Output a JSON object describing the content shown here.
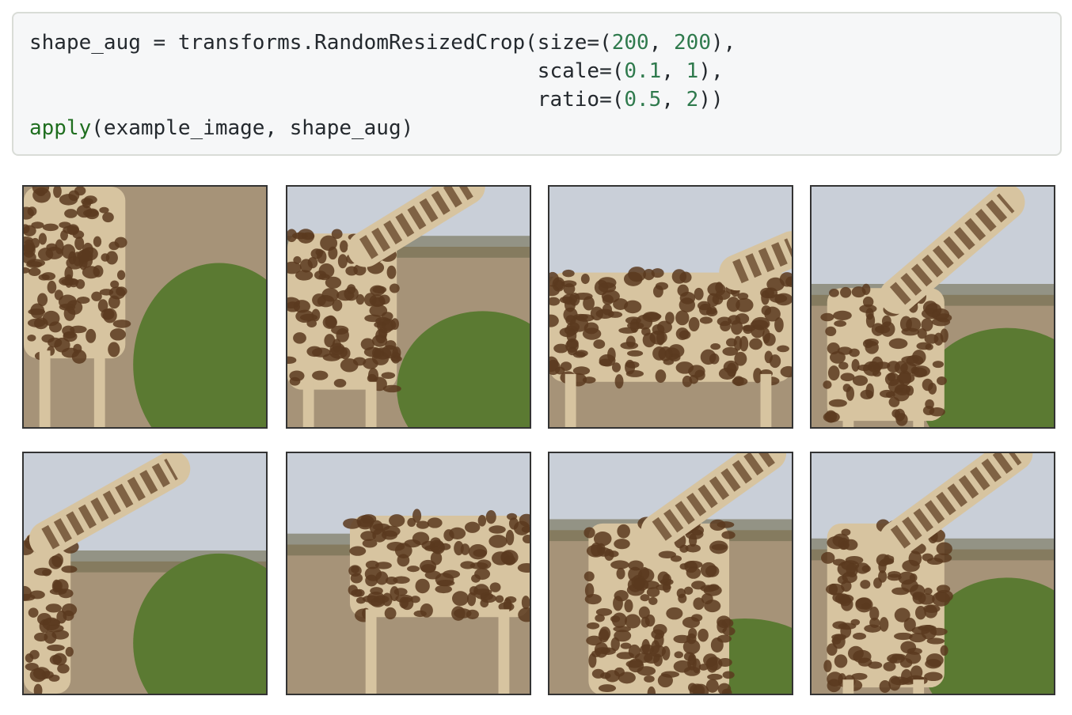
{
  "code": {
    "line1": {
      "var": "shape_aug",
      "eq": " = ",
      "call": "transforms.RandomResizedCrop(size=(",
      "n1": "200",
      "sep": ", ",
      "n2": "200",
      "end": "),"
    },
    "line2": {
      "indent": "                                         ",
      "kw": "scale=(",
      "n1": "0.1",
      "sep": ", ",
      "n2": "1",
      "end": "),"
    },
    "line3": {
      "indent": "                                         ",
      "kw": "ratio=(",
      "n1": "0.5",
      "sep": ", ",
      "n2": "2",
      "end": "))"
    },
    "line4": {
      "fn": "apply",
      "args": "(example_image, shape_aug)"
    }
  },
  "output_images": {
    "count": 8,
    "rows": 2,
    "cols": 4,
    "subject": "giraffe",
    "colors": {
      "sky": "#c9cfd8",
      "grass": "#a69378",
      "bush": "#5b7a32",
      "giraffe_base": "#d7c4a0",
      "giraffe_spot": "#5b3a1e",
      "frame": "#333333"
    }
  }
}
